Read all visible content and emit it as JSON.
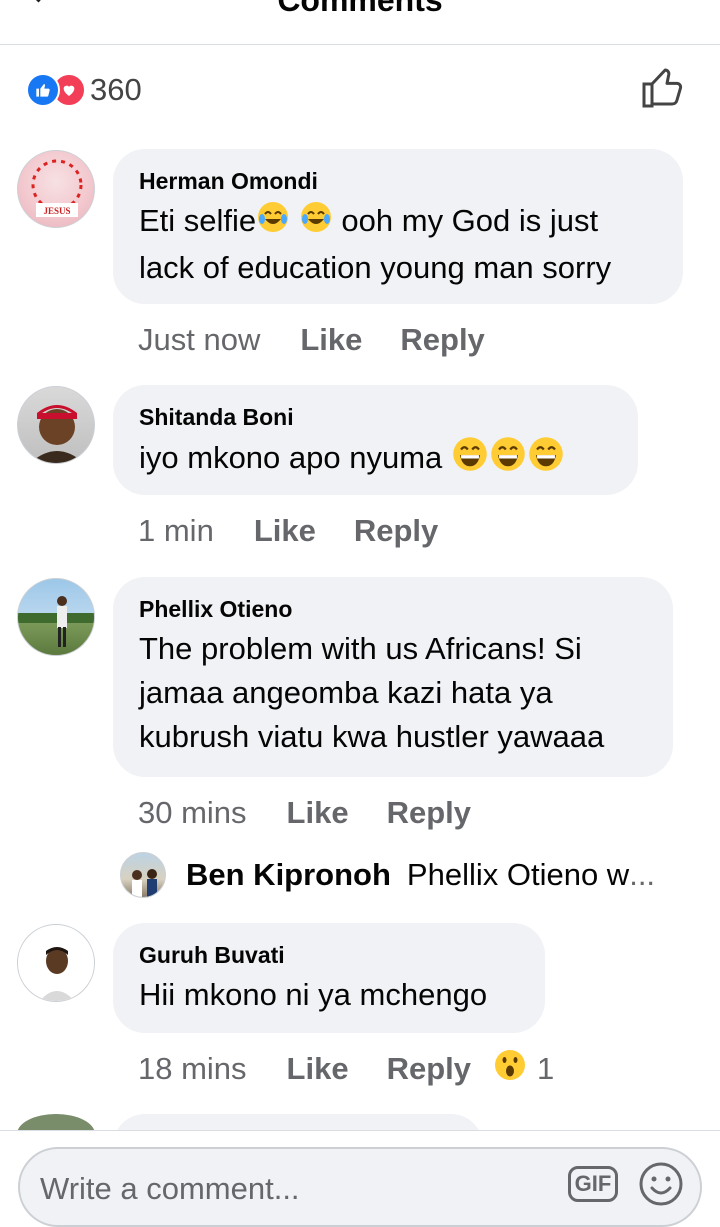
{
  "header": {
    "title": "Comments"
  },
  "reactions": {
    "count": "360",
    "types": [
      "like",
      "love"
    ]
  },
  "comments": [
    {
      "author": "Herman Omondi",
      "text_parts": [
        "Eti selfie",
        " ooh my God is just lack of education young man sorry"
      ],
      "emojis": [
        "tears-of-joy-emoji",
        "tears-of-joy-emoji"
      ],
      "time": "Just now",
      "like": "Like",
      "reply": "Reply",
      "avatar_text": "JESUS"
    },
    {
      "author": "Shitanda Boni",
      "text": "iyo mkono apo nyuma",
      "emojis": [
        "grinning-emoji",
        "grinning-emoji",
        "grinning-emoji"
      ],
      "time": "1 min",
      "like": "Like",
      "reply": "Reply"
    },
    {
      "author": "Phellix Otieno",
      "text": "The problem with us Africans! Si jamaa angeomba kazi hata ya kubrush viatu kwa hustler yawaaa",
      "time": "30 mins",
      "like": "Like",
      "reply": "Reply"
    },
    {
      "author": "Guruh Buvati",
      "text": "Hii mkono ni ya mchengo",
      "time": "18 mins",
      "like": "Like",
      "reply": "Reply",
      "reaction_emoji": "wow-emoji",
      "reaction_count": "1"
    }
  ],
  "reply_preview": {
    "author": "Ben Kipronoh",
    "text": "Phellix Otieno w",
    "ellipsis": "..."
  },
  "composer": {
    "placeholder": "Write a comment...",
    "gif_label": "GIF"
  },
  "colors": {
    "accent": "#1877f2",
    "love": "#f33e58",
    "bubble": "#f0f2f5",
    "muted": "#65676b"
  }
}
